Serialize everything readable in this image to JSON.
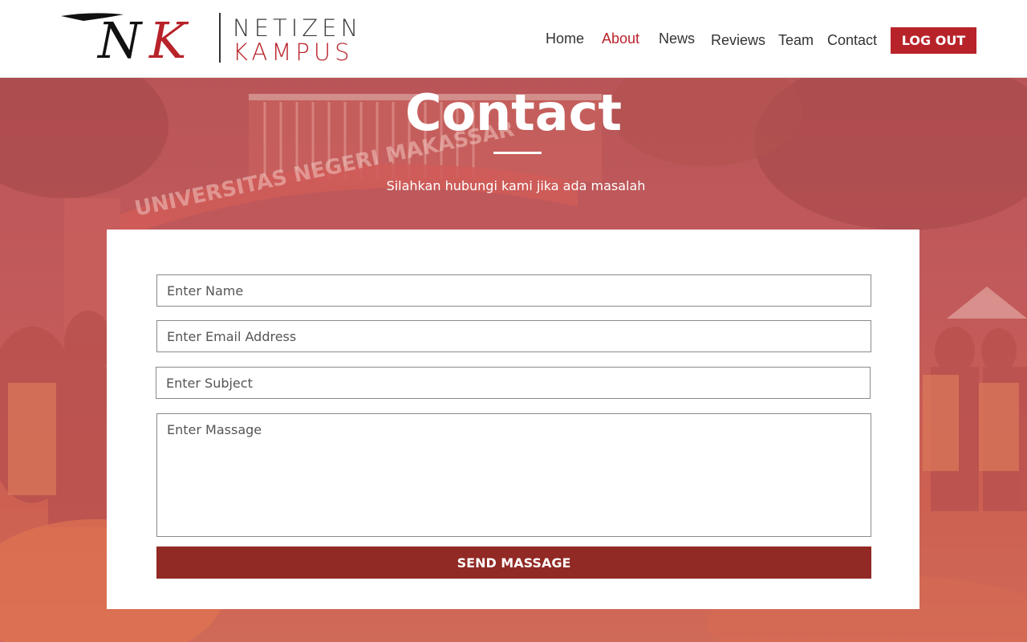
{
  "brand": {
    "mark": "NK",
    "name_top": "NETIZEN",
    "name_bottom": "KAMPUS",
    "colors": {
      "red": "#b8232a",
      "dark": "#3a3a3a"
    }
  },
  "nav": {
    "items": [
      {
        "label": "Home",
        "active": false
      },
      {
        "label": "About",
        "active": true
      },
      {
        "label": "News",
        "active": false
      },
      {
        "label": "Reviews",
        "active": false
      },
      {
        "label": "Team",
        "active": false
      },
      {
        "label": "Contact",
        "active": false
      }
    ],
    "logout_label": "LOG OUT"
  },
  "hero": {
    "title": "Contact",
    "subtitle": "Silahkan hubungi kami jika ada masalah",
    "sign_text": "UNIVERSITAS NEGERI MAKASSAR"
  },
  "form": {
    "name_placeholder": "Enter Name",
    "email_placeholder": "Enter Email Address",
    "subject_placeholder": "Enter Subject",
    "message_placeholder": "Enter Massage",
    "submit_label": "SEND MASSAGE",
    "button_color": "#912924"
  }
}
